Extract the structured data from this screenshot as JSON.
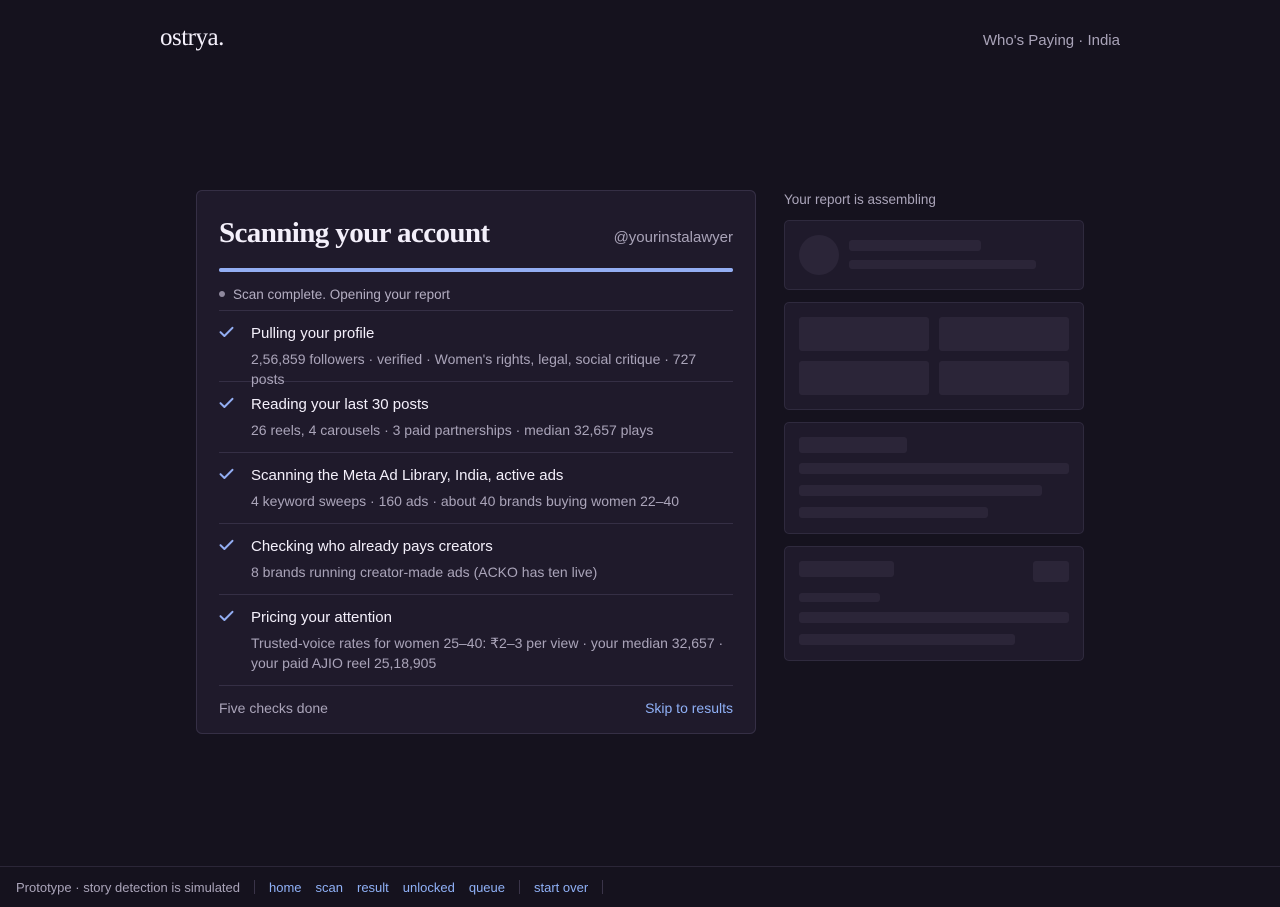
{
  "header": {
    "logo": "ostrya.",
    "nav_label": "Who's Paying · India"
  },
  "scan": {
    "title": "Scanning your account",
    "handle": "@yourinstalawyer",
    "progress_fraction": 1.0,
    "status": "Scan complete. Opening your report",
    "steps": [
      {
        "title": "Pulling your profile",
        "detail": "2,56,859 followers · verified · Women's rights, legal, social critique · 727 posts"
      },
      {
        "title": "Reading your last 30 posts",
        "detail": "26 reels, 4 carousels · 3 paid partnerships · median 32,657 plays"
      },
      {
        "title": "Scanning the Meta Ad Library, India, active ads",
        "detail": "4 keyword sweeps · 160 ads · about 40 brands buying women 22–40"
      },
      {
        "title": "Checking who already pays creators",
        "detail": "8 brands running creator-made ads (ACKO has ten live)"
      },
      {
        "title": "Pricing your attention",
        "detail": "Trusted-voice rates for women 25–40: ₹2–3 per view · your median 32,657 · your paid AJIO reel 25,18,905"
      }
    ],
    "footer_text": "Five checks done",
    "skip_label": "Skip to results"
  },
  "report": {
    "label": "Your report is assembling"
  },
  "footer": {
    "prototype_note": "Prototype · story detection is simulated",
    "links": [
      "home",
      "scan",
      "result",
      "unlocked",
      "queue"
    ],
    "start_over": "start over"
  },
  "colors": {
    "background": "#15121e",
    "card": "#1f1a2b",
    "accent": "#93aef3",
    "link": "#8fb0f6"
  }
}
